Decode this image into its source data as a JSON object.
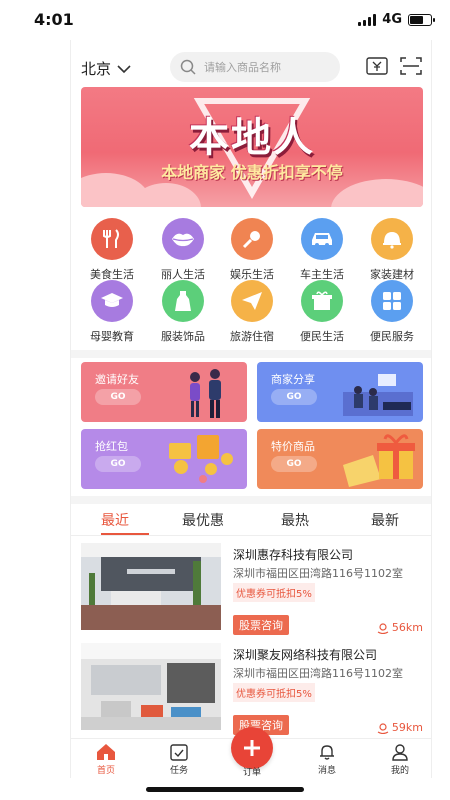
{
  "status_bar": {
    "time": "4:01",
    "network": "4G"
  },
  "header": {
    "city": "北京",
    "search_placeholder": "请输入商品名称"
  },
  "banner": {
    "title": "本地人",
    "subtitle": "本地商家 优惠折扣享不停"
  },
  "categories": [
    {
      "label": "美食生活",
      "icon": "cutlery-icon",
      "color": "#e8604c"
    },
    {
      "label": "丽人生活",
      "icon": "lips-icon",
      "color": "#a77be0"
    },
    {
      "label": "娱乐生活",
      "icon": "microphone-icon",
      "color": "#f08452"
    },
    {
      "label": "车主生活",
      "icon": "car-icon",
      "color": "#5b9ff0"
    },
    {
      "label": "家装建材",
      "icon": "lamp-icon",
      "color": "#f5b248"
    },
    {
      "label": "母婴教育",
      "icon": "graduation-cap-icon",
      "color": "#a77be0"
    },
    {
      "label": "服装饰品",
      "icon": "dress-icon",
      "color": "#5ccf7a"
    },
    {
      "label": "旅游住宿",
      "icon": "paper-plane-icon",
      "color": "#f5b248"
    },
    {
      "label": "便民生活",
      "icon": "gift-icon",
      "color": "#5ccf7a"
    },
    {
      "label": "便民服务",
      "icon": "grid-icon",
      "color": "#5b9ff0"
    }
  ],
  "promos": [
    {
      "title": "邀请好友",
      "go": "GO",
      "color": "#f07d86"
    },
    {
      "title": "商家分享",
      "go": "GO",
      "color": "#6f8ff0"
    },
    {
      "title": "抢红包",
      "go": "GO",
      "color": "#b58ae8"
    },
    {
      "title": "特价商品",
      "go": "GO",
      "color": "#f08a5a"
    }
  ],
  "tabs": [
    "最近",
    "最优惠",
    "最热",
    "最新"
  ],
  "active_tab": "最近",
  "merchants": [
    {
      "name": "深圳惠存科技有限公司",
      "address": "深圳市福田区田湾路116号1102室",
      "coupon": "优惠券可抵扣5%",
      "button": "股票咨询",
      "distance": "56km"
    },
    {
      "name": "深圳聚友网络科技有限公司",
      "address": "深圳市福田区田湾路116号1102室",
      "coupon": "优惠券可抵扣5%",
      "button": "股票咨询",
      "distance": "59km"
    }
  ],
  "bottom_nav": [
    {
      "label": "首页",
      "icon": "home-icon"
    },
    {
      "label": "任务",
      "icon": "task-icon"
    },
    {
      "label": "订单",
      "icon": "plus-icon"
    },
    {
      "label": "消息",
      "icon": "bell-icon"
    },
    {
      "label": "我的",
      "icon": "user-icon"
    }
  ],
  "colors": {
    "accent": "#e8573e",
    "nav_center": "#e84437"
  }
}
